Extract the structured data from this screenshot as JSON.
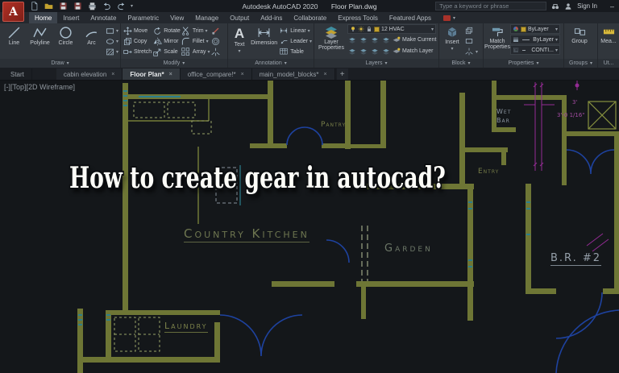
{
  "titlebar": {
    "app_title": "Autodesk AutoCAD 2020",
    "doc_title": "Floor Plan.dwg",
    "search_placeholder": "Type a keyword or phrase",
    "sign_in": "Sign In",
    "minimize_glyph": "–"
  },
  "ribbon": {
    "tabs": [
      "Home",
      "Insert",
      "Annotate",
      "Parametric",
      "View",
      "Manage",
      "Output",
      "Add-ins",
      "Collaborate",
      "Express Tools",
      "Featured Apps"
    ],
    "active_tab": "Home",
    "draw": {
      "label": "Draw",
      "tools": [
        "Line",
        "Polyline",
        "Circle",
        "Arc"
      ]
    },
    "modify": {
      "label": "Modify",
      "tools": [
        "Move",
        "Copy",
        "Stretch",
        "Rotate",
        "Mirror",
        "Scale",
        "Trim",
        "Fillet",
        "Array"
      ]
    },
    "annotation": {
      "label": "Annotation",
      "text": "Text",
      "dimension": "Dimension",
      "tools": [
        "Linear",
        "Leader",
        "Table"
      ]
    },
    "layers": {
      "label": "Layers",
      "layer_properties": "Layer Properties",
      "current_layer": "12 HVAC",
      "make_current": "Make Current",
      "match_layer": "Match Layer"
    },
    "block": {
      "label": "Block",
      "insert": "Insert"
    },
    "properties": {
      "label": "Properties",
      "match_properties": "Match Properties",
      "color": "ByLayer",
      "lineweight": "ByLayer",
      "linetype": "CONTI..."
    },
    "groups": {
      "label": "Groups",
      "group": "Group"
    },
    "utilities": {
      "label": "Ut...",
      "measure": "Mea..."
    }
  },
  "file_tabs": {
    "tabs": [
      {
        "label": "Start",
        "closable": false,
        "active": false
      },
      {
        "label": "cabin elevation",
        "closable": true,
        "active": false
      },
      {
        "label": "Floor Plan*",
        "closable": true,
        "active": true
      },
      {
        "label": "office_compare!*",
        "closable": true,
        "active": false
      },
      {
        "label": "main_model_blocks*",
        "closable": true,
        "active": false
      }
    ],
    "close_glyph": "×",
    "new_tab_glyph": "+"
  },
  "canvas": {
    "viewport_controls": "[-][Top][2D Wireframe]",
    "overlay_title": "How to create gear in autocad?",
    "rooms": {
      "pantry": "Pantry",
      "country_kitchen": "Country Kitchen",
      "garden": "Garden",
      "entry": "Entry",
      "wet_bar_line1": "Wet",
      "wet_bar_line2": "Bar",
      "br2": "B.R. #2",
      "laundry": "Laundry"
    },
    "dimensions": {
      "dim_width": "3'-0 1/16\"",
      "dim_small": "3'"
    },
    "colors": {
      "walls": "#6e7635",
      "doors": "#1e429f",
      "dimensions": "#942b94",
      "fixtures": "#2c7f8e",
      "background": "#14171a",
      "accent_red": "#a8322a"
    }
  }
}
